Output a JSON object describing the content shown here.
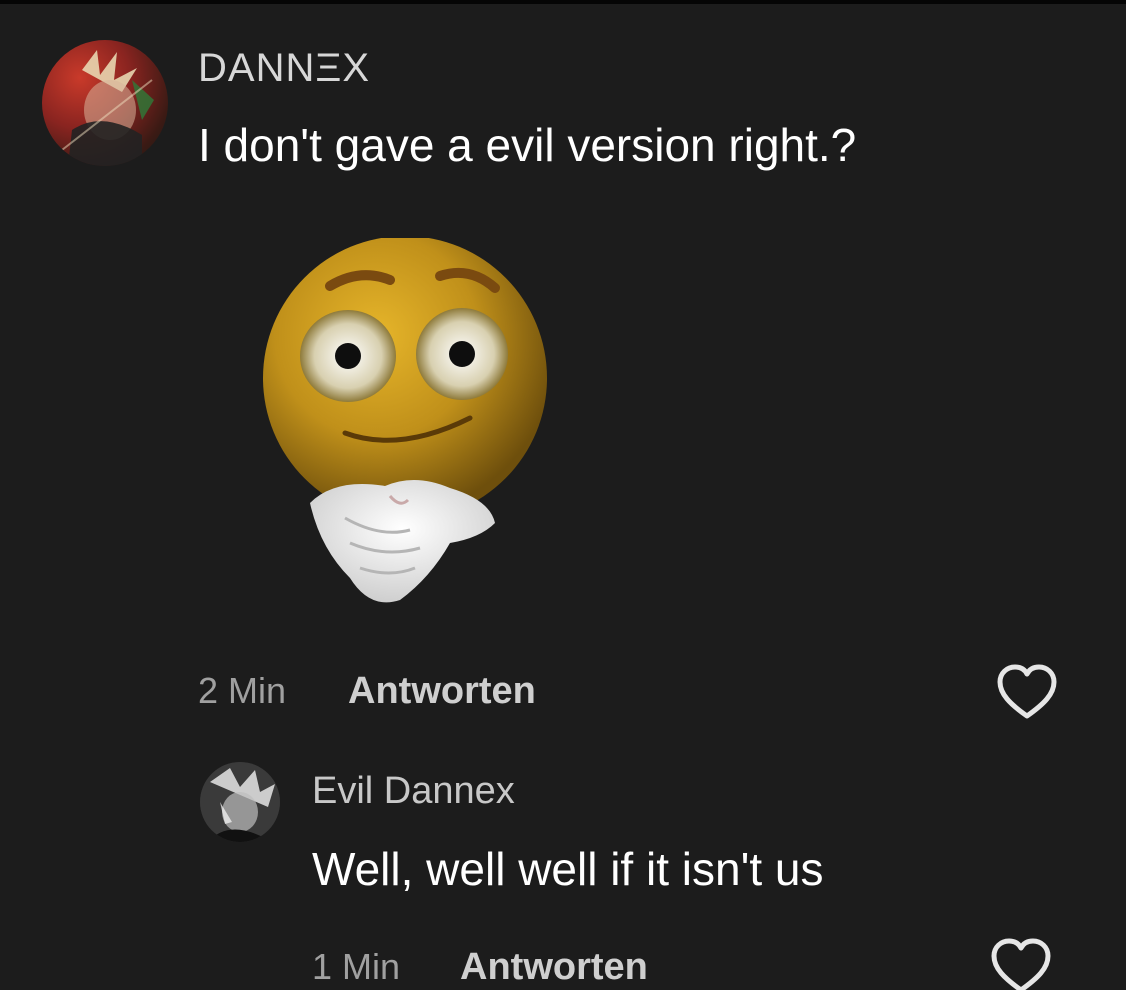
{
  "main_comment": {
    "username": "DANNΞX",
    "text": "I don't gave a evil version right.?",
    "sticker": "hands-together-smiley-sticker",
    "time": "2 Min",
    "reply_label": "Antworten",
    "like_icon": "heart-outline-icon"
  },
  "reply": {
    "username": "Evil Dannex",
    "text": "Well, well well if it isn't us",
    "time": "1 Min",
    "reply_label": "Antworten",
    "like_icon": "heart-outline-icon"
  },
  "colors": {
    "background": "#1c1c1c",
    "text_primary": "#ffffff",
    "text_secondary": "#a0a0a0",
    "username": "#d7d7d7"
  }
}
